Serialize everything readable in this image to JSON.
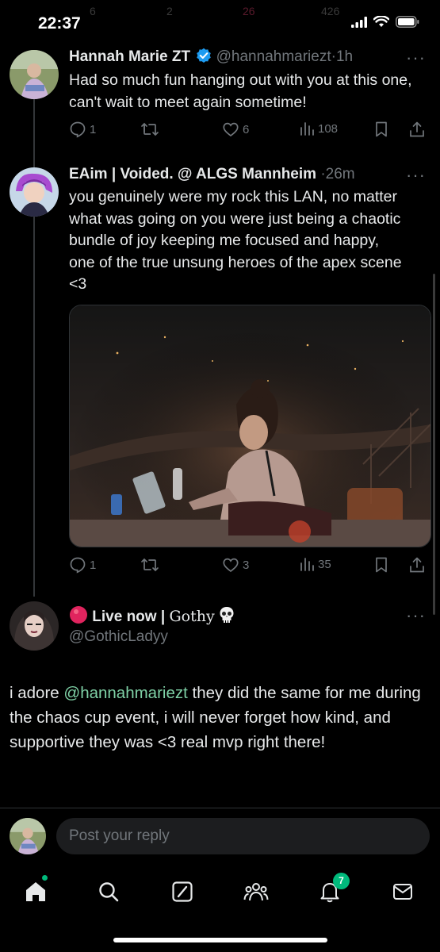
{
  "status_bar": {
    "time": "22:37",
    "ghost_counts": [
      "6",
      "2",
      "26",
      "426"
    ],
    "icons": [
      "cellular-signal-icon",
      "wifi-icon",
      "battery-icon"
    ]
  },
  "tweets": [
    {
      "name": "Hannah Marie ZT",
      "verified": true,
      "handle": "@hannahmariezt",
      "separator": "·",
      "time": "1h",
      "text": "Had so much fun hanging out with you at this one, can't wait to meet again sometime!",
      "replies": "1",
      "reposts": "",
      "likes": "6",
      "views": "108"
    },
    {
      "name": "EAim | Voided. @ ALGS Mannheim",
      "handle": "",
      "separator": "·",
      "time": "26m",
      "text": "you genuinely were my rock this LAN, no matter what was going on you were just being a chaotic bundle of joy keeping me focused and happy, one of the true unsung heroes of the apex scene <3",
      "replies": "1",
      "reposts": "",
      "likes": "3",
      "views": "35"
    },
    {
      "live_label": "Live now",
      "name_separator": "|",
      "name": "Gothy",
      "handle": "@GothicLadyy",
      "text_before": "i adore ",
      "mention": "@hannahmariezt",
      "text_after": " they did the same for me during the chaos cup event, i will never forget how kind, and supportive they was <3 real mvp right there!"
    }
  ],
  "reply_box": {
    "placeholder": "Post your reply"
  },
  "bottom_nav": {
    "items": [
      "home-icon",
      "search-icon",
      "grok-icon",
      "communities-icon",
      "notifications-icon",
      "messages-icon"
    ],
    "notification_count": "7"
  },
  "colors": {
    "background": "#000000",
    "text": "#e7e9ea",
    "secondary": "#71767b",
    "verified": "#1d9bf0",
    "mention": "#7fd1a6",
    "live": "#e0245e",
    "badge": "#00ba7c"
  }
}
